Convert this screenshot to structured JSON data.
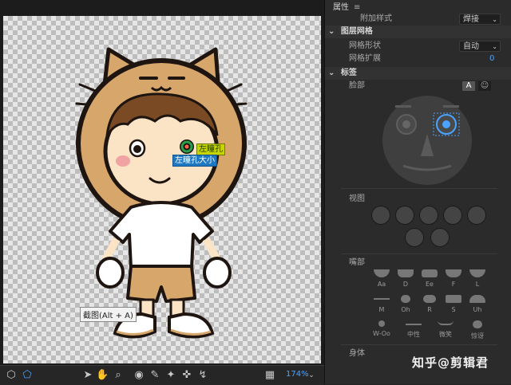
{
  "stage": {
    "tags": {
      "left_pupil": "左瞳孔",
      "left_pupil_size": "左瞳孔大小"
    },
    "tooltip": "截图(Alt + A)"
  },
  "toolbar": {
    "zoom": "174%"
  },
  "panel": {
    "properties_title": "属性",
    "attach_style_label": "附加样式",
    "attach_style_value": "焊接",
    "layer_mesh_section": "图层网格",
    "mesh_shape_label": "网格形状",
    "mesh_shape_value": "自动",
    "mesh_expand_label": "网格扩展",
    "mesh_expand_value": "0",
    "tags_section": "标签",
    "face_label": "脸部",
    "face_toggle_a": "A",
    "face_toggle_b": "☺",
    "view_label": "视图",
    "mouth_label": "嘴部",
    "mouth_shapes": [
      {
        "label": "Aa"
      },
      {
        "label": "D"
      },
      {
        "label": "Ee"
      },
      {
        "label": "F"
      },
      {
        "label": "L"
      },
      {
        "label": "M"
      },
      {
        "label": "Oh"
      },
      {
        "label": "R"
      },
      {
        "label": "S"
      },
      {
        "label": "Uh"
      },
      {
        "label": "W-Oo"
      },
      {
        "label": "中性"
      },
      {
        "label": "微笑"
      },
      {
        "label": "惊讶"
      }
    ],
    "body_label": "身体"
  },
  "watermark": "知乎@剪辑君"
}
